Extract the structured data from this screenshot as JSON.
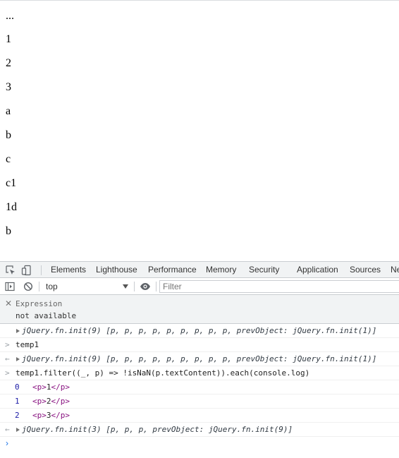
{
  "page": {
    "paragraphs": [
      "...",
      "1",
      "2",
      "3",
      "a",
      "b",
      "c",
      "c1",
      "1d",
      "b"
    ]
  },
  "devtools": {
    "tabs": [
      "Elements",
      "Lighthouse",
      "Performance",
      "Memory",
      "Security",
      "Application",
      "Sources",
      "Ne"
    ],
    "context": "top",
    "filter_placeholder": "Filter",
    "live_expression": {
      "label": "Expression",
      "value": "not available"
    },
    "console": {
      "result_1": "jQuery.fn.init(9) [p, p, p, p, p, p, p, p, p, prevObject: jQuery.fn.init(1)]",
      "input_1": "temp1",
      "result_2": "jQuery.fn.init(9) [p, p, p, p, p, p, p, p, p, prevObject: jQuery.fn.init(1)]",
      "input_2": "temp1.filter((_, p) => !isNaN(p.textContent)).each(console.log)",
      "logs": [
        {
          "index": "0",
          "open": "<p>",
          "text": "1",
          "close": "</p>"
        },
        {
          "index": "1",
          "open": "<p>",
          "text": "2",
          "close": "</p>"
        },
        {
          "index": "2",
          "open": "<p>",
          "text": "3",
          "close": "</p>"
        }
      ],
      "result_3": "jQuery.fn.init(3) [p, p, p, prevObject: jQuery.fn.init(9)]",
      "input_chevron": ">",
      "output_chevron": "←",
      "prompt_chevron": "›"
    },
    "icons": [
      "inspect-element-icon",
      "device-toolbar-icon",
      "show-sidebar-icon",
      "clear-console-icon",
      "eye-icon",
      "close-icon",
      "expand-triangle-icon"
    ],
    "colors": {
      "accent": "#1a73e8",
      "tag": "#881280",
      "number": "#1a1aa6"
    }
  }
}
